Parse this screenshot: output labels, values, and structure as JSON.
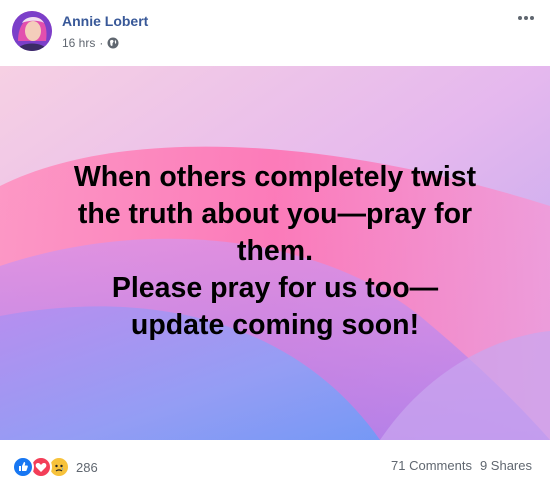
{
  "post": {
    "author": "Annie Lobert",
    "time": "16 hrs",
    "separator": "·",
    "privacy_icon": "globe-icon",
    "menu_icon": "more-horizontal-icon"
  },
  "content": {
    "lines": [
      "When others completely twist",
      "the truth about you—pray for",
      "them.",
      "Please pray for us too—",
      "update coming soon!"
    ],
    "background_colors": [
      "#f2c8e6",
      "#c8a2ec",
      "#7aa0f5",
      "#ff7fb8"
    ]
  },
  "footer": {
    "reaction_icons": [
      "like-icon",
      "love-icon",
      "sad-icon"
    ],
    "reaction_count": "286",
    "comments": "71 Comments",
    "shares": "9 Shares"
  },
  "colors": {
    "author": "#385898",
    "meta": "#606770",
    "like": "#1877f2",
    "love": "#f33e58",
    "sad": "#f7c23b"
  }
}
